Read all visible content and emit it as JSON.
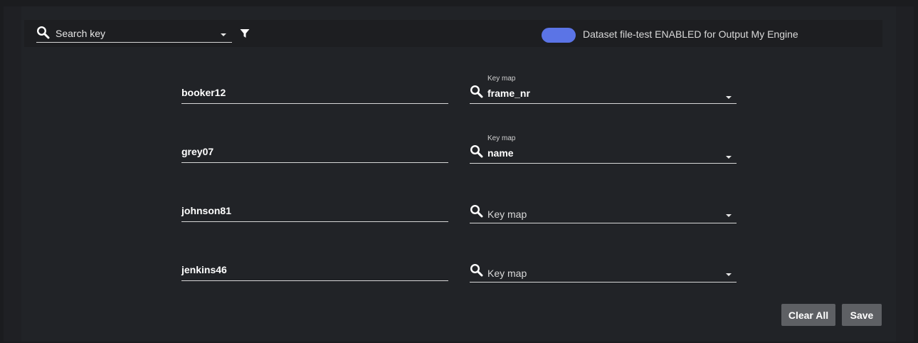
{
  "toolbar": {
    "search_placeholder": "Search key",
    "toggle_label": "Dataset file-test ENABLED for Output My Engine",
    "toggle_on": true,
    "toggle_color": "#5b74e6"
  },
  "mappings": [
    {
      "key": "booker12",
      "map_label": "Key map",
      "map_value": "frame_nr",
      "map_placeholder": ""
    },
    {
      "key": "grey07",
      "map_label": "Key map",
      "map_value": "name",
      "map_placeholder": ""
    },
    {
      "key": "johnson81",
      "map_label": "",
      "map_value": "",
      "map_placeholder": "Key map"
    },
    {
      "key": "jenkins46",
      "map_label": "",
      "map_value": "",
      "map_placeholder": "Key map"
    }
  ],
  "actions": {
    "clear_all": "Clear All",
    "save": "Save"
  },
  "icons": {
    "search": "search-icon",
    "filter": "filter-icon",
    "dropdown": "chevron-down-icon"
  }
}
